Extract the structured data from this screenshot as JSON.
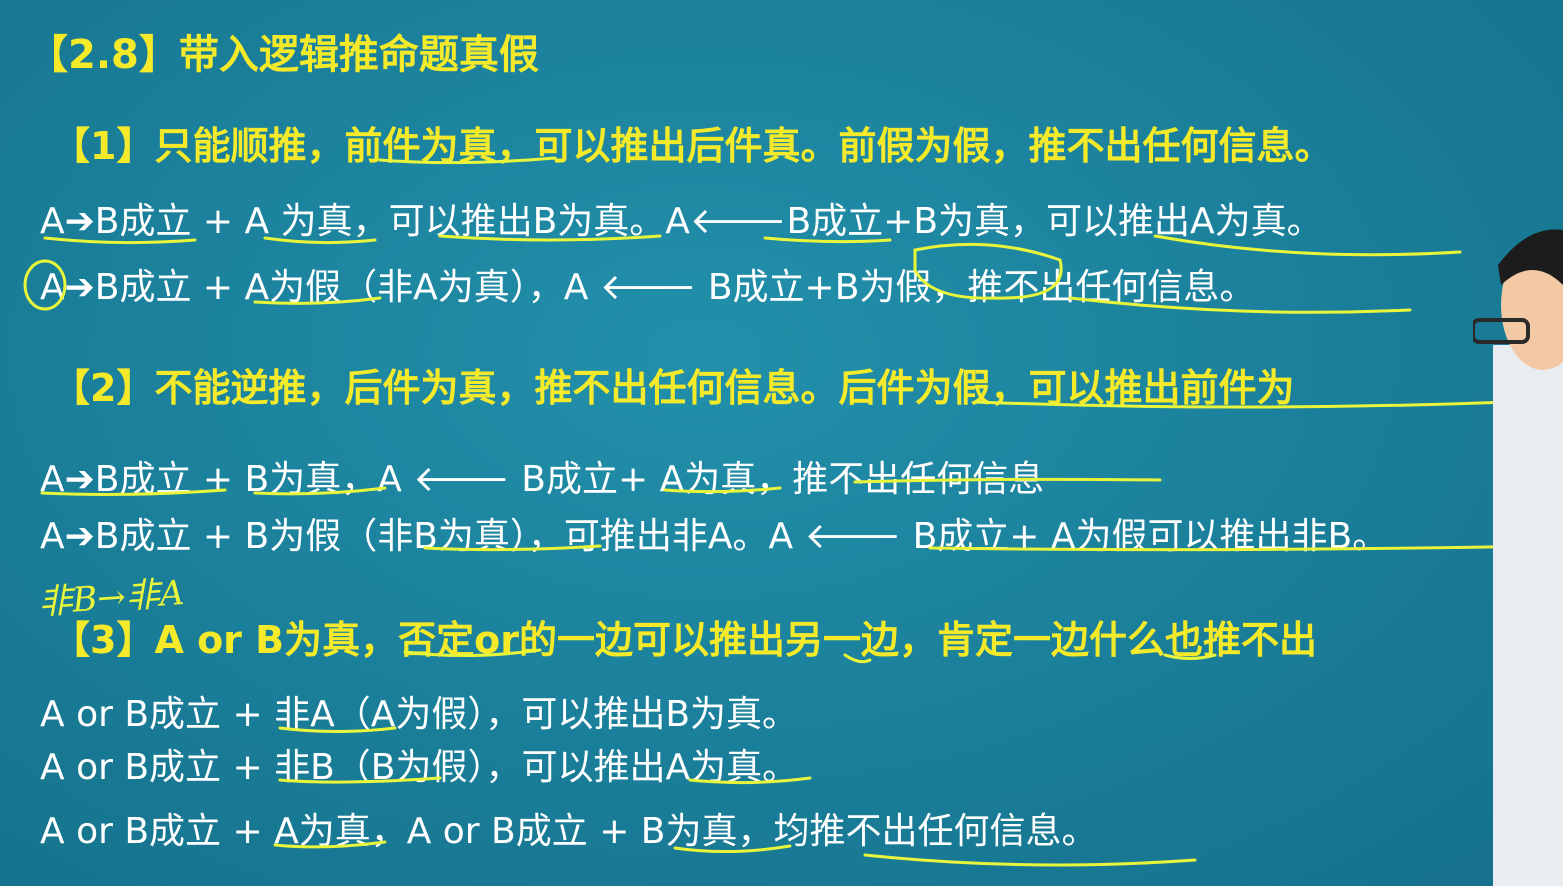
{
  "title": "【2.8】带入逻辑推命题真假",
  "section1": {
    "heading": "【1】只能顺推，前件为真，可以推出后件真。前假为假，推不出任何信息。",
    "line1": "A➔B成立 + A 为真，可以推出B为真。A🡐B成立+B为真，可以推出A为真。",
    "line2": "A➔B成立 + A为假（非A为真），A 🡐 B成立+B为假，推不出任何信息。"
  },
  "section2": {
    "heading": "【2】不能逆推，后件为真，推不出任何信息。后件为假，可以推出前件为",
    "line1": "A➔B成立 + B为真，A 🡐 B成立+ A为真，推不出任何信息",
    "line2": "A➔B成立 + B为假（非B为真），可推出非A。A 🡐 B成立+ A为假可以推出非B。"
  },
  "handwriting": "非B→非A",
  "section3": {
    "heading": "【3】A or B为真，否定or的一边可以推出另一边，肯定一边什么也推不出",
    "line1": "A or B成立 + 非A（A为假），可以推出B为真。",
    "line2": "A or B成立 + 非B（B为假），可以推出A为真。",
    "line3": "A or B成立 + A为真，A or B成立 + B为真，均推不出任何信息。"
  },
  "colors": {
    "background": "#1b7f9b",
    "heading": "#f4ea2a",
    "body": "#ffffff",
    "ink": "#e9f53a"
  }
}
